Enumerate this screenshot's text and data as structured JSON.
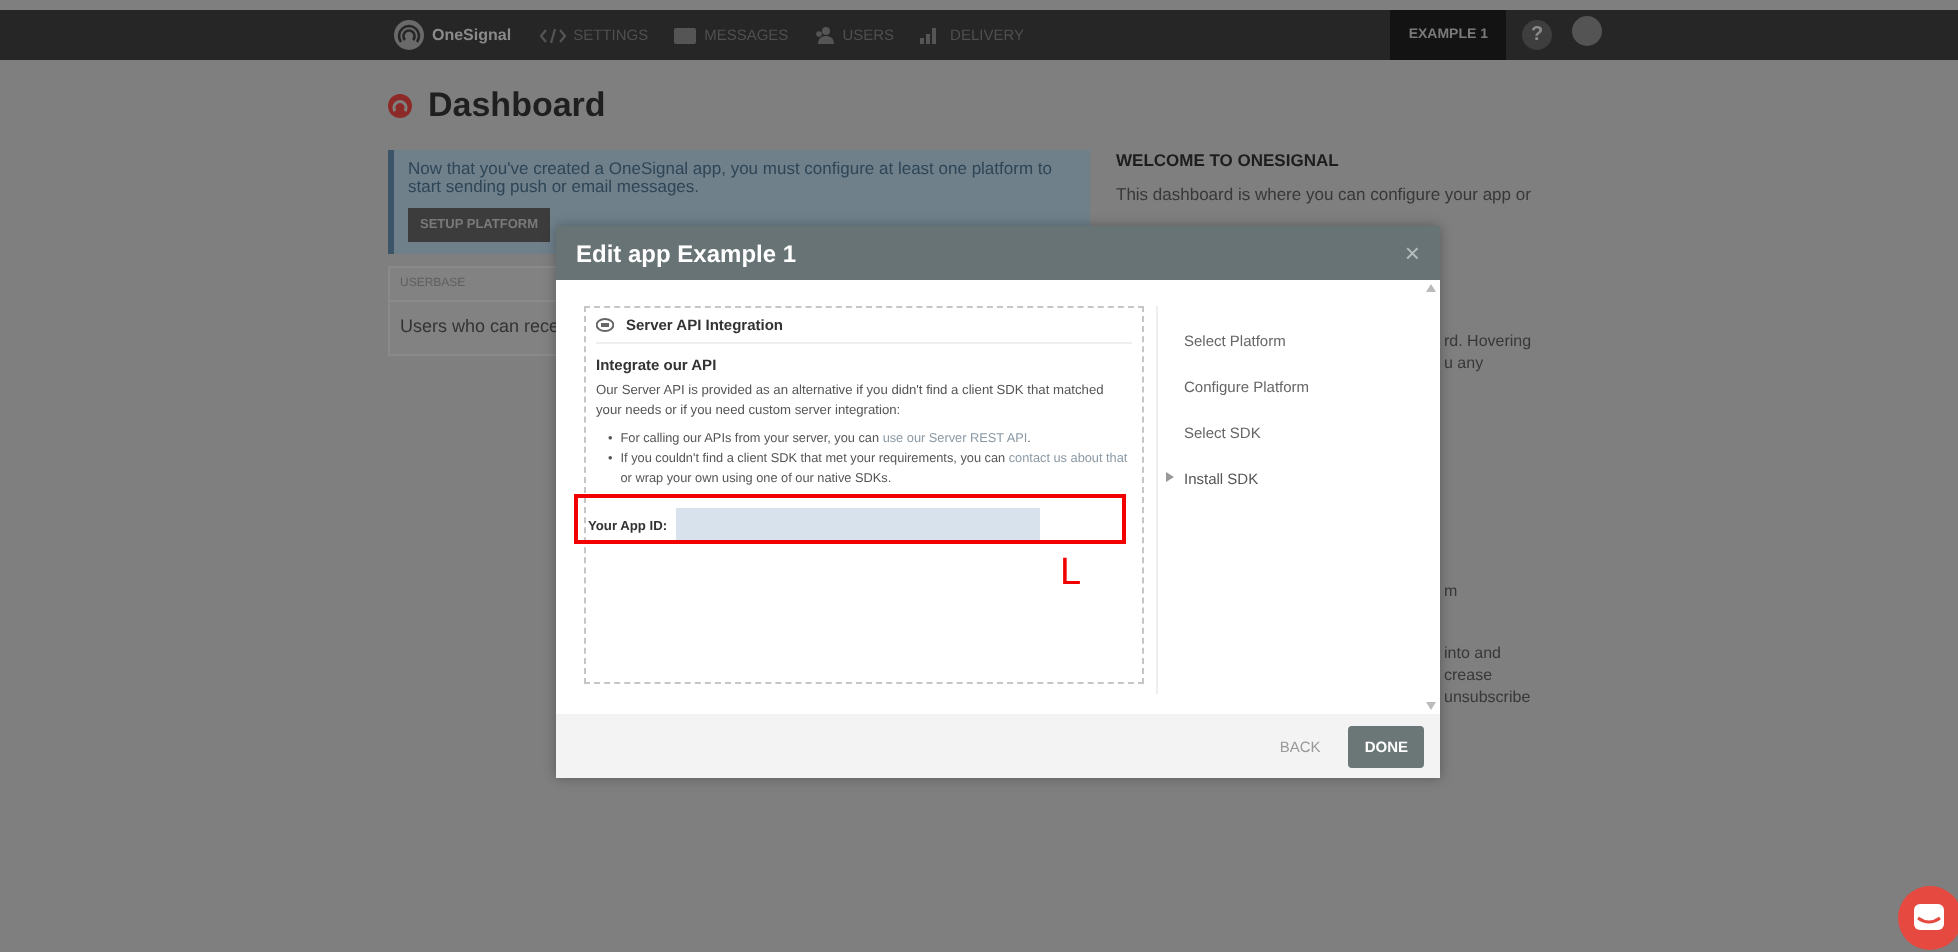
{
  "topbar": {
    "brand": "OneSignal",
    "nav": [
      {
        "kind": "code",
        "label": "SETTINGS"
      },
      {
        "kind": "messages",
        "label": "MESSAGES"
      },
      {
        "kind": "users",
        "label": "USERS"
      },
      {
        "kind": "delivery",
        "label": "DELIVERY"
      }
    ],
    "app": "EXAMPLE 1",
    "help": "?"
  },
  "page_title": "Dashboard",
  "notice": {
    "text": "Now that you've created a OneSignal app, you must configure at least one platform to start sending push or email messages.",
    "button": "SETUP PLATFORM"
  },
  "userbase": {
    "heading": "USERBASE",
    "text": "Users who can rece"
  },
  "welcome": {
    "heading": "WELCOME TO ONESIGNAL",
    "text": "This dashboard is where you can configure your app or",
    "fragments": [
      [
        "rd. Hovering",
        "u any"
      ],
      [
        "m"
      ],
      [
        "into and",
        "crease",
        "unsubscribe"
      ]
    ]
  },
  "modal": {
    "title": "Edit app Example 1",
    "close": "×",
    "panel": {
      "title": "Server API Integration",
      "heading": "Integrate our API",
      "intro": "Our Server API is provided as an alternative if you didn't find a client SDK that matched your needs or if you need custom server integration:",
      "bullets": [
        {
          "marker": "•",
          "parts": [
            {
              "text": "For calling our APIs from your server, you can ",
              "link": false
            },
            {
              "text": "use our Server REST API",
              "link": true
            },
            {
              "text": ".",
              "link": false
            }
          ]
        },
        {
          "marker": "•",
          "parts": [
            {
              "text": "If you couldn't find a client SDK that met your requirements, you can ",
              "link": false
            },
            {
              "text": "contact us about that",
              "link": true
            },
            {
              "text": " or wrap your own using one of our native SDKs.",
              "link": false
            }
          ]
        }
      ],
      "app_id_label": "Your App ID:"
    },
    "steps": [
      {
        "label": "Select Platform",
        "selected": false
      },
      {
        "label": "Configure Platform",
        "selected": false
      },
      {
        "label": "Select SDK",
        "selected": false
      },
      {
        "label": "Install SDK",
        "selected": true
      }
    ],
    "back": "BACK",
    "done": "DONE"
  },
  "annotation": {
    "label": "L"
  }
}
